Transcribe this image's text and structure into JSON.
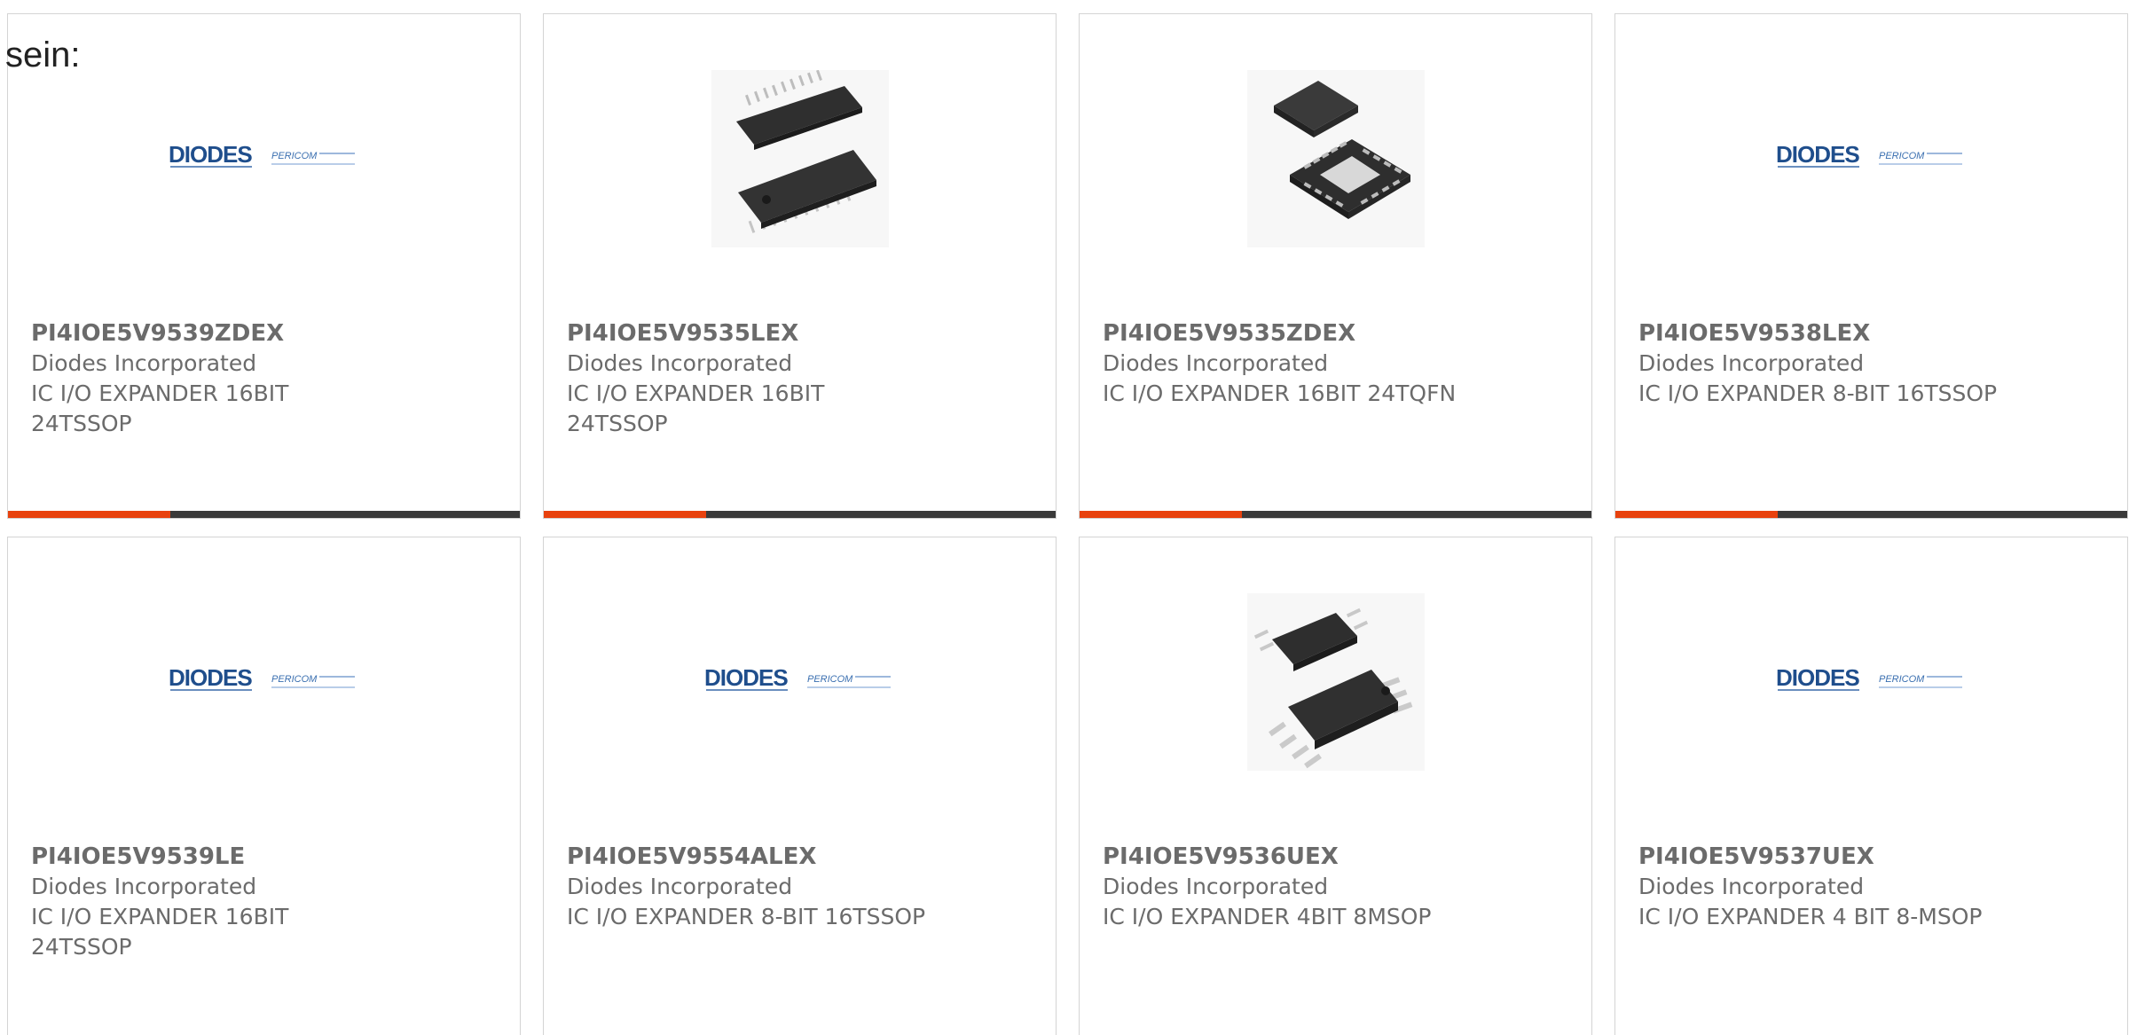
{
  "intro_text": "sein:",
  "accent_color": "#e8420e",
  "products": [
    {
      "part": "PI4IOE5V9539ZDEX",
      "maker": "Diodes Incorporated",
      "desc": "IC I/O EXPANDER 16BIT 24TSSOP",
      "image": "diodes-pericom-logo"
    },
    {
      "part": "PI4IOE5V9535LEX",
      "maker": "Diodes Incorporated",
      "desc": "IC I/O EXPANDER 16BIT 24TSSOP",
      "image": "tssop-chip-photo"
    },
    {
      "part": "PI4IOE5V9535ZDEX",
      "maker": "Diodes Incorporated",
      "desc": "IC I/O EXPANDER 16BIT 24TQFN",
      "image": "tqfn-chip-photo"
    },
    {
      "part": "PI4IOE5V9538LEX",
      "maker": "Diodes Incorporated",
      "desc": "IC I/O EXPANDER 8-BIT 16TSSOP",
      "image": "diodes-pericom-logo"
    },
    {
      "part": "PI4IOE5V9539LE",
      "maker": "Diodes Incorporated",
      "desc": "IC I/O EXPANDER 16BIT 24TSSOP",
      "image": "diodes-pericom-logo"
    },
    {
      "part": "PI4IOE5V9554ALEX",
      "maker": "Diodes Incorporated",
      "desc": "IC I/O EXPANDER 8-BIT 16TSSOP",
      "image": "diodes-pericom-logo"
    },
    {
      "part": "PI4IOE5V9536UEX",
      "maker": "Diodes Incorporated",
      "desc": "IC I/O EXPANDER 4BIT 8MSOP",
      "image": "msop-chip-photo"
    },
    {
      "part": "PI4IOE5V9537UEX",
      "maker": "Diodes Incorporated",
      "desc": "IC I/O EXPANDER 4 BIT 8-MSOP",
      "image": "diodes-pericom-logo"
    }
  ]
}
